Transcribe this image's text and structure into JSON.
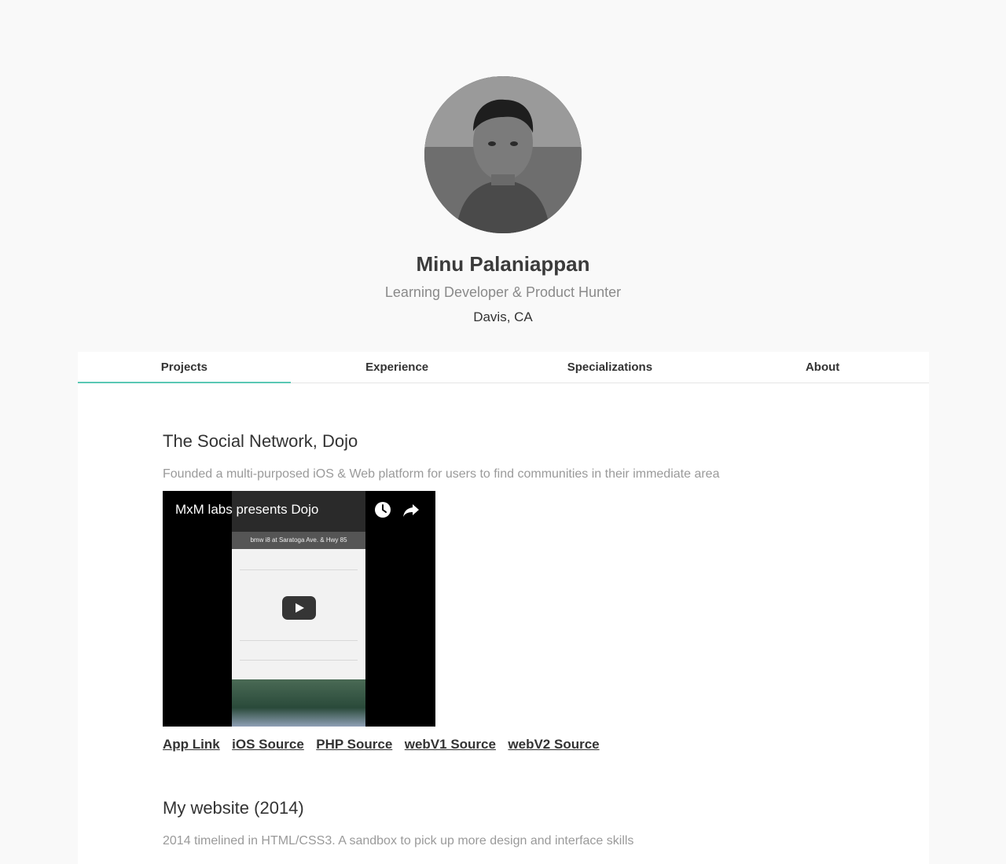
{
  "profile": {
    "name": "Minu Palaniappan",
    "tagline": "Learning Developer & Product Hunter",
    "location": "Davis, CA"
  },
  "tabs": [
    {
      "label": "Projects",
      "active": true
    },
    {
      "label": "Experience",
      "active": false
    },
    {
      "label": "Specializations",
      "active": false
    },
    {
      "label": "About",
      "active": false
    }
  ],
  "projects": [
    {
      "title": "The Social Network, Dojo",
      "description": "Founded a multi-purposed iOS & Web platform for users to find communities in their immediate area",
      "video_title": "MxM labs presents Dojo",
      "video_post_title": "bmw i8 at Saratoga Ave. & Hwy 85",
      "links": [
        "App Link",
        "iOS Source",
        "PHP Source",
        "webV1 Source",
        "webV2 Source"
      ]
    },
    {
      "title": "My website (2014)",
      "description": "2014 timelined in HTML/CSS3. A sandbox to pick up more design and interface skills"
    }
  ],
  "colors": {
    "page_background": "#f9f9f9",
    "card_background": "#ffffff",
    "accent": "#5ac8b4",
    "muted_text": "#9a9a9a"
  },
  "icons": {
    "video_watch_later": "clock-icon",
    "video_share": "share-icon",
    "video_play": "play-icon"
  }
}
